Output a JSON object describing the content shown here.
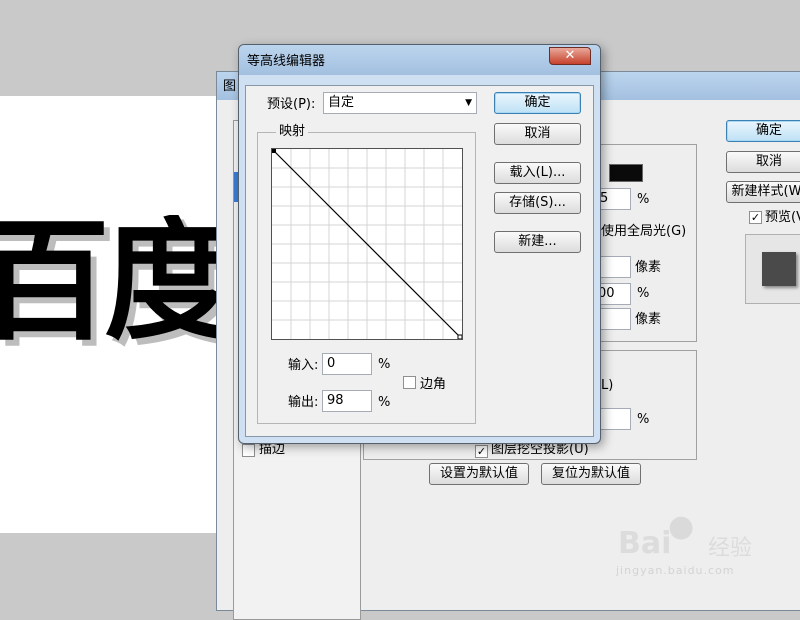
{
  "canvas": {
    "chars": "百度"
  },
  "layer_style": {
    "title_partial": "图",
    "ok_label": "确定",
    "cancel_label": "取消",
    "new_style_label": "新建样式(W)",
    "preview_label": "预览(V)",
    "preview_checked": true,
    "percent_1": "5",
    "percent_unit": "%",
    "global_light_label": "使用全局光(G)",
    "pixel_unit": "像素",
    "percent_2": "00",
    "ko_label": "图层挖空投影(U)",
    "ko_checked": true,
    "set_default_label": "设置为默认值",
    "reset_default_label": "复位为默认值",
    "stroke_label": "描边",
    "partial_L": "L)",
    "shadow_color": "#0a0a0a",
    "preview_swatch_color": "#4a4a4a"
  },
  "contour_editor": {
    "title": "等高线编辑器",
    "close_icon": "close-icon",
    "preset_label": "预设(P):",
    "preset_value": "自定",
    "mapping_label": "映射",
    "input_label": "输入:",
    "input_value": "0",
    "output_label": "输出:",
    "output_value": "98",
    "percent_unit": "%",
    "corner_label": "边角",
    "corner_checked": false,
    "ok_label": "确定",
    "cancel_label": "取消",
    "load_label": "载入(L)...",
    "save_label": "存储(S)...",
    "new_label": "新建...",
    "curve": {
      "start": [
        0,
        100
      ],
      "end": [
        100,
        0
      ]
    }
  },
  "watermark": {
    "brand": "Bai",
    "brand_suffix": "经验",
    "url": "jingyan.baidu.com"
  }
}
